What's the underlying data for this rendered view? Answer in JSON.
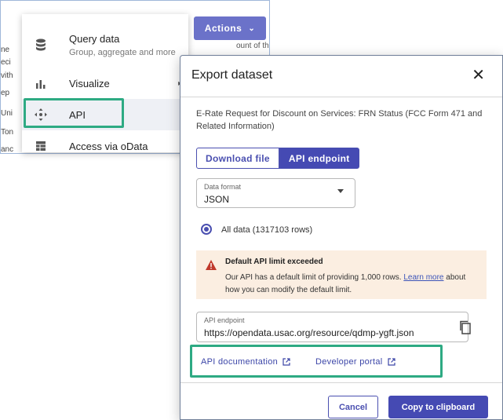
{
  "background": {
    "fragments": [
      "ne",
      "eci",
      "vith",
      "ep",
      "Uni",
      "Ton",
      "anc"
    ],
    "top_right_text": "ount of the servic"
  },
  "actions_button": {
    "label": "Actions",
    "chevron": "⌄"
  },
  "menu": {
    "items": [
      {
        "label": "Query data",
        "sublabel": "Group, aggregate and more",
        "icon": "database-icon"
      },
      {
        "label": "Visualize",
        "icon": "bar-chart-icon"
      },
      {
        "label": "API",
        "icon": "move-arrows-icon"
      },
      {
        "label": "Access via oData",
        "icon": "table-icon"
      }
    ]
  },
  "modal": {
    "title": "Export dataset",
    "close": "✕",
    "dataset_name": "E-Rate Request for Discount on Services: FRN Status (FCC Form 471 and Related Information)",
    "tabs": {
      "download": "Download file",
      "api": "API endpoint"
    },
    "format": {
      "label": "Data format",
      "value": "JSON"
    },
    "radio_label": "All data (1317103 rows)",
    "warning": {
      "title": "Default API limit exceeded",
      "body_pre": "Our API has a default limit of providing 1,000 rows. ",
      "link": "Learn more",
      "body_post": " about how you can modify the default limit."
    },
    "endpoint": {
      "label": "API endpoint",
      "value": "https://opendata.usac.org/resource/qdmp-ygft.json"
    },
    "links": {
      "docs": "API documentation",
      "portal": "Developer portal"
    },
    "buttons": {
      "cancel": "Cancel",
      "copy": "Copy to clipboard"
    }
  },
  "colors": {
    "accent": "#454ab3",
    "highlight": "#2eaa83",
    "warning_bg": "#fbeee1",
    "warning_icon": "#c0392b"
  }
}
